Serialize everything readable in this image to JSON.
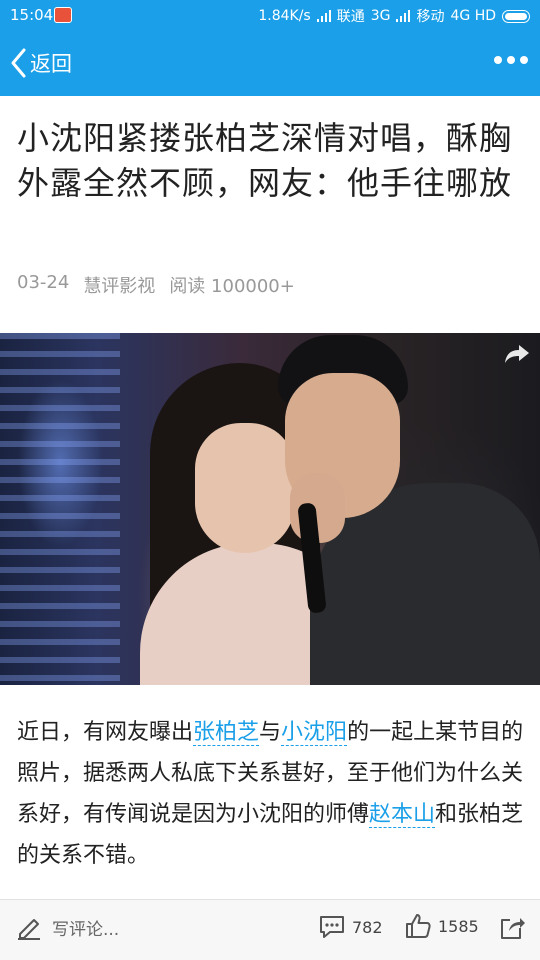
{
  "status_bar": {
    "time": "15:04",
    "net_speed": "1.84K/s",
    "carrier1": "联通",
    "net1": "3G",
    "carrier2": "移动",
    "net2": "4G HD"
  },
  "nav": {
    "back_label": "返回"
  },
  "article": {
    "title": "小沈阳紧搂张柏芝深情对唱，酥胸外露全然不顾，网友：他手往哪放",
    "date": "03-24",
    "source": "慧评影视",
    "reads": "阅读 100000+",
    "body": {
      "p1": "近日，有网友曝出",
      "link1": "张柏芝",
      "p2": "与",
      "link2": "小沈阳",
      "p3": "的一起上某节目的照片，据悉两人私底下关系甚好，至于他们为什么关系好，有传闻说是因为小沈阳的师傅",
      "link3": "赵本山",
      "p4": "和张柏芝的关系不错。"
    }
  },
  "bottom_bar": {
    "write_placeholder": "写评论...",
    "comment_count": "782",
    "like_count": "1585"
  },
  "colors": {
    "accent": "#1a9fe8"
  }
}
